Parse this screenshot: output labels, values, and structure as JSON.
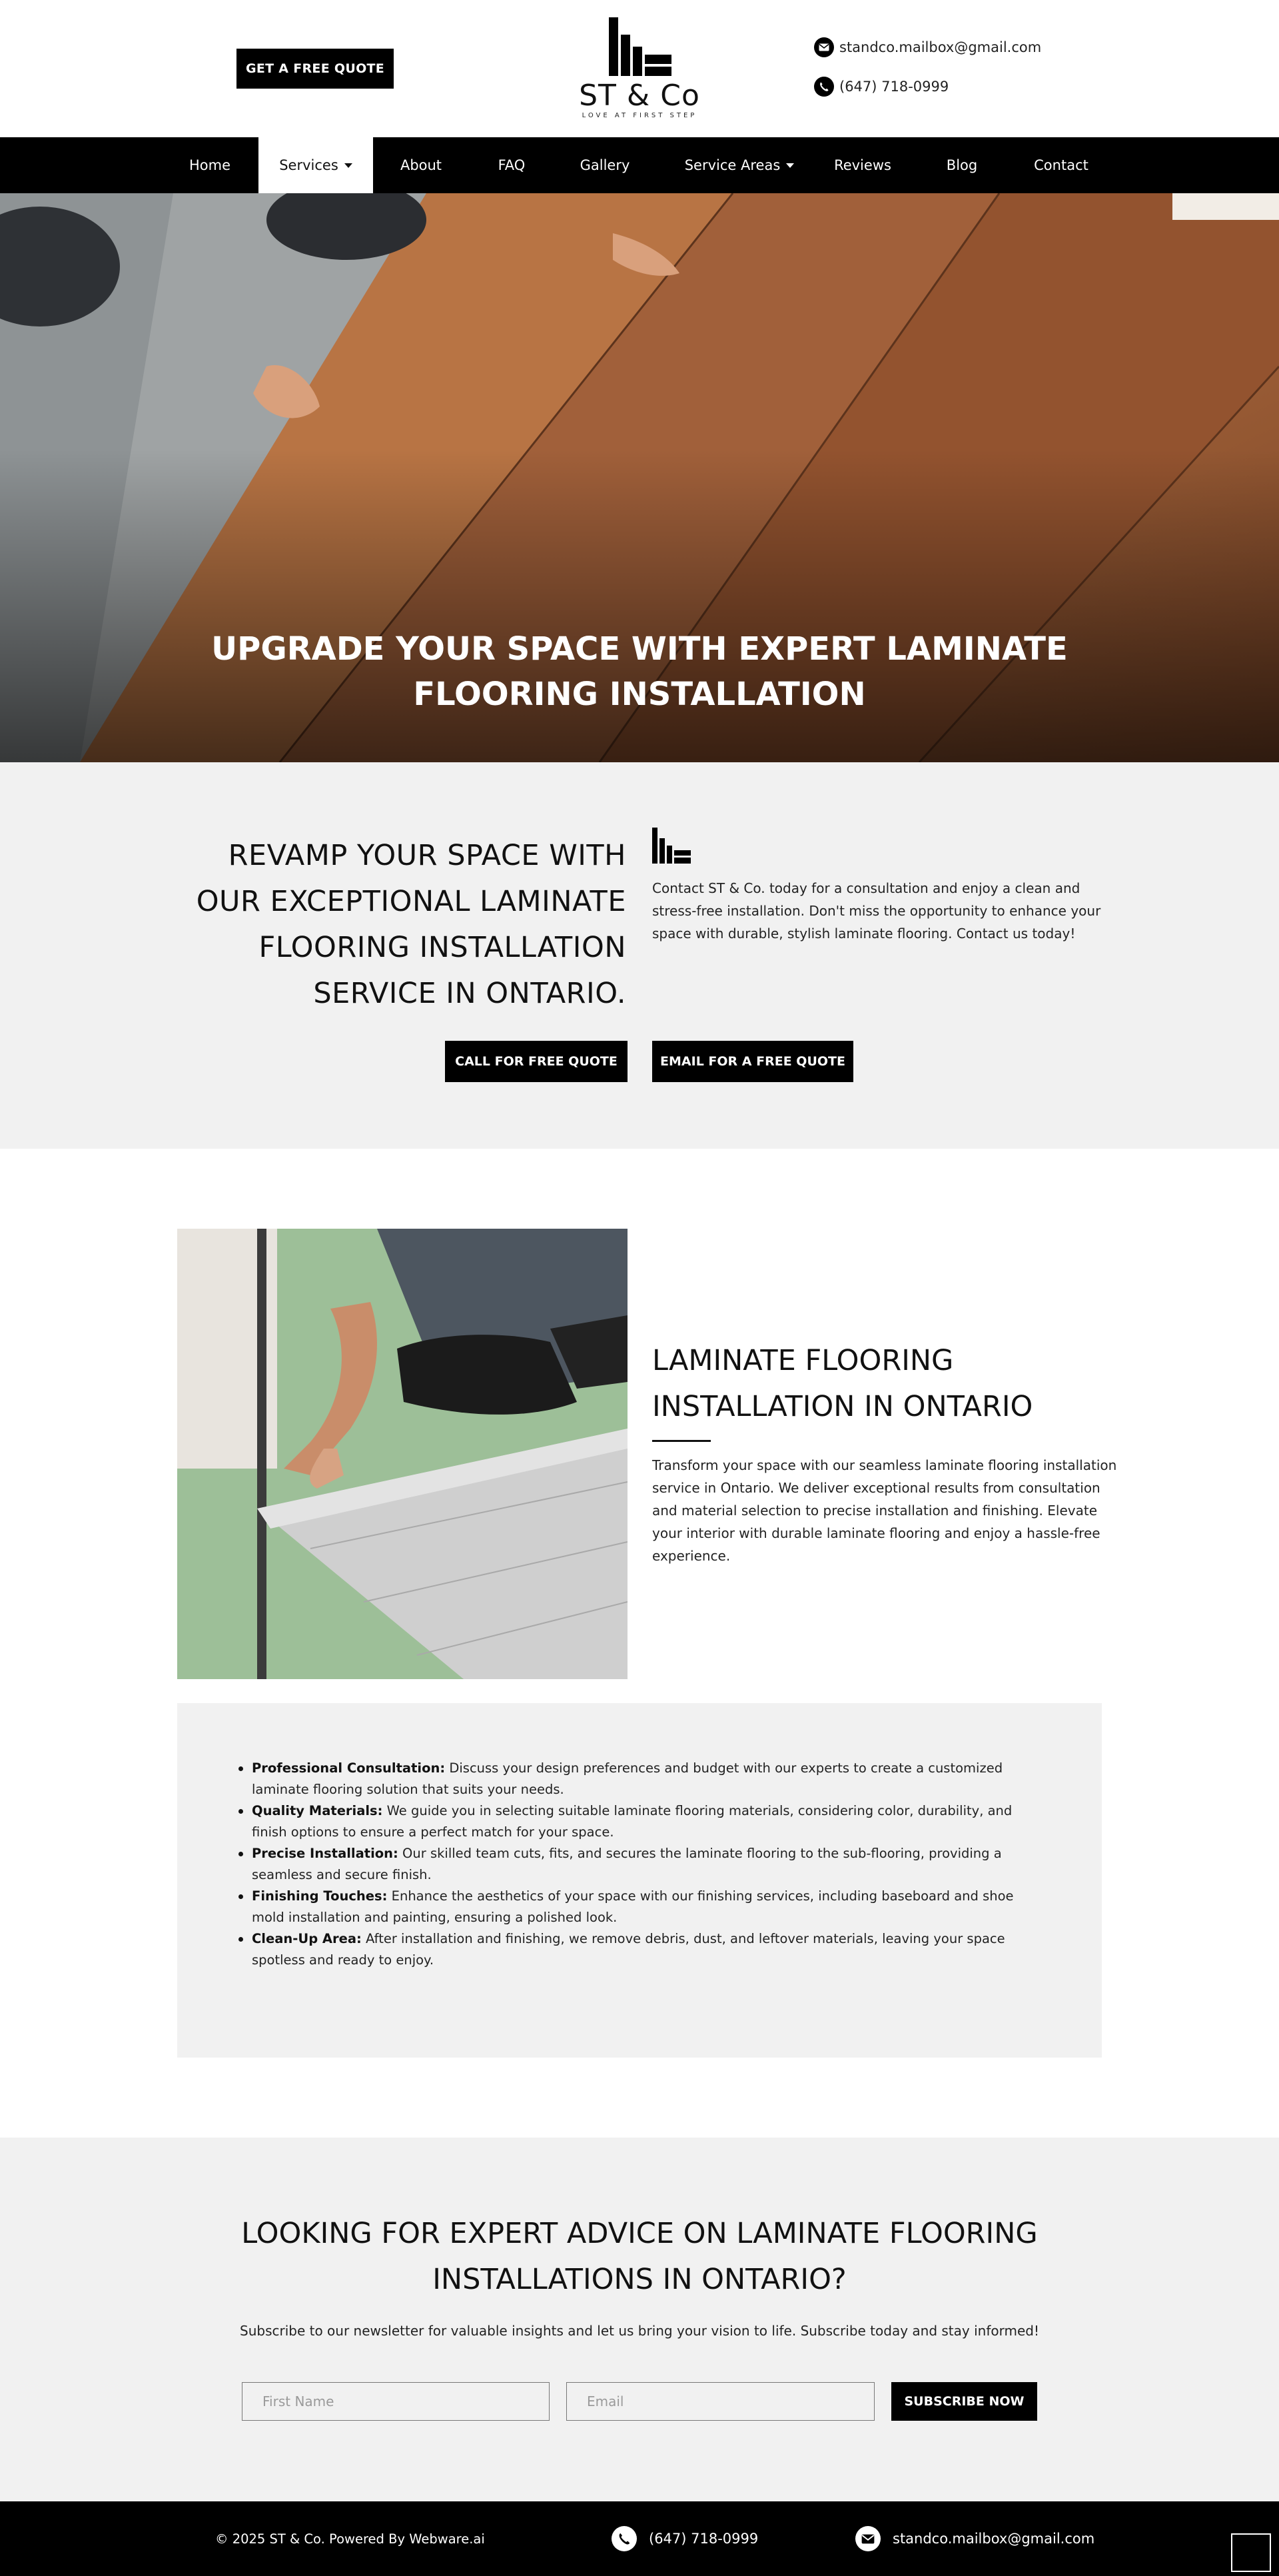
{
  "header": {
    "quote_button": "GET A FREE QUOTE",
    "logo_name": "ST & Co",
    "logo_tagline": "LOVE AT FIRST STEP",
    "email": "standco.mailbox@gmail.com",
    "phone": "(647) 718-0999"
  },
  "nav": {
    "items": [
      {
        "label": "Home"
      },
      {
        "label": "Services"
      },
      {
        "label": "About"
      },
      {
        "label": "FAQ"
      },
      {
        "label": "Gallery"
      },
      {
        "label": "Service Areas"
      },
      {
        "label": "Reviews"
      },
      {
        "label": "Blog"
      },
      {
        "label": "Contact"
      }
    ],
    "active": "Services"
  },
  "hero": {
    "title": "UPGRADE YOUR SPACE WITH EXPERT LAMINATE FLOORING INSTALLATION"
  },
  "revamp": {
    "title": "REVAMP YOUR SPACE WITH OUR EXCEPTIONAL LAMINATE FLOORING INSTALLATION SERVICE IN ONTARIO.",
    "text": "Contact ST & Co. today for a consultation and enjoy a clean and stress-free installation. Don't miss the opportunity to enhance your space with durable, stylish laminate flooring. Contact us today!",
    "call_button": "CALL FOR FREE QUOTE",
    "email_button": "EMAIL FOR A FREE QUOTE"
  },
  "laminate": {
    "title": "LAMINATE FLOORING INSTALLATION IN ONTARIO",
    "text": "Transform your space with our seamless laminate flooring installation service in Ontario. We deliver exceptional results from consultation and material selection to precise installation and finishing. Elevate your interior with durable laminate flooring and enjoy a hassle-free experience."
  },
  "features": [
    {
      "title": "Professional Consultation:",
      "text": " Discuss your design preferences and budget with our experts to create a customized laminate flooring solution that suits your needs."
    },
    {
      "title": "Quality Materials:",
      "text": " We guide you in selecting suitable laminate flooring materials, considering color, durability, and finish options to ensure a perfect match for your space."
    },
    {
      "title": "Precise Installation:",
      "text": " Our skilled team cuts, fits, and secures the laminate flooring to the sub-flooring, providing a seamless and secure finish."
    },
    {
      "title": "Finishing Touches:",
      "text": " Enhance the aesthetics of your space with our finishing services, including baseboard and shoe mold installation and painting, ensuring a polished look."
    },
    {
      "title": "Clean-Up Area:",
      "text": " After installation and finishing, we remove debris, dust, and leftover materials, leaving your space spotless and ready to enjoy."
    }
  ],
  "newsletter": {
    "title": "LOOKING FOR EXPERT ADVICE ON LAMINATE FLOORING INSTALLATIONS IN ONTARIO?",
    "subtitle": "Subscribe to our newsletter for valuable insights and let us bring your vision to life. Subscribe today and stay informed!",
    "first_name_placeholder": "First Name",
    "email_placeholder": "Email",
    "button": "SUBSCRIBE NOW"
  },
  "footer": {
    "copyright": "© 2025 ST & Co. Powered By Webware.ai",
    "phone": "(647) 718-0999",
    "email": "standco.mailbox@gmail.com"
  },
  "icons": {
    "email": "envelope-icon",
    "phone": "phone-icon",
    "dropdown": "caret-down-icon"
  },
  "colors": {
    "primary": "#000000",
    "section_bg": "#f1f1f1",
    "text": "#111111"
  }
}
